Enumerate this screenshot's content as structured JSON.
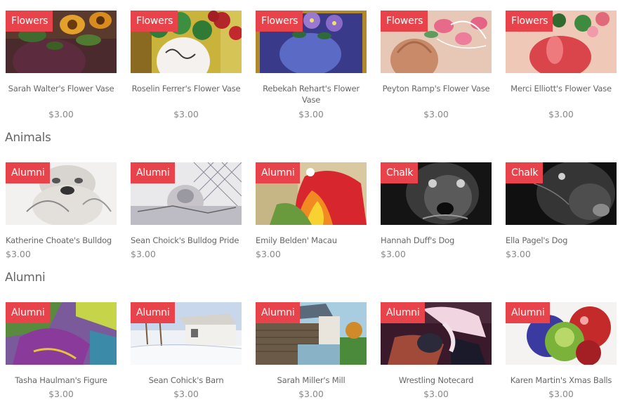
{
  "sections": [
    {
      "heading": "",
      "items": [
        {
          "badge": "Flowers",
          "title": "Sarah Walter's Flower Vase",
          "price": "$3.00",
          "art": "sunflower-vase"
        },
        {
          "badge": "Flowers",
          "title": "Roselin Ferrer's Flower Vase",
          "price": "$3.00",
          "art": "rose-white-vase"
        },
        {
          "badge": "Flowers",
          "title": "Rebekah Rehart's Flower Vase",
          "price": "$3.00",
          "art": "blue-vase-daisies"
        },
        {
          "badge": "Flowers",
          "title": "Peyton Ramp's Flower Vase",
          "price": "$3.00",
          "art": "pink-flowers-vase"
        },
        {
          "badge": "Flowers",
          "title": "Merci Elliott's Flower Vase",
          "price": "$3.00",
          "art": "red-vase-roses"
        }
      ]
    },
    {
      "heading": "Animals",
      "items": [
        {
          "badge": "Alumni",
          "title": "Katherine Choate's Bulldog",
          "price": "$3.00",
          "art": "bulldog-sketch"
        },
        {
          "badge": "Alumni",
          "title": "Sean Choick's Bulldog Pride",
          "price": "$3.00",
          "art": "bulldog-fence"
        },
        {
          "badge": "Alumni",
          "title": "Emily Belden' Macau",
          "price": "$3.00",
          "art": "macaw"
        },
        {
          "badge": "Chalk",
          "title": "Hannah Duff's Dog",
          "price": "$3.00",
          "art": "dog-chalk-1"
        },
        {
          "badge": "Chalk",
          "title": "Ella Pagel's Dog",
          "price": "$3.00",
          "art": "dog-chalk-2"
        }
      ]
    },
    {
      "heading": "Alumni",
      "items": [
        {
          "badge": "Alumni",
          "title": "Tasha Haulman's Figure",
          "price": "$3.00",
          "art": "abstract-figure"
        },
        {
          "badge": "Alumni",
          "title": "Sean Cohick's Barn",
          "price": "$3.00",
          "art": "snowy-barn"
        },
        {
          "badge": "Alumni",
          "title": "Sarah Miller's Mill",
          "price": "$3.00",
          "art": "mill"
        },
        {
          "badge": "Alumni",
          "title": "Wrestling Notecard",
          "price": "$3.00",
          "art": "wrestling"
        },
        {
          "badge": "Alumni",
          "title": "Karen Martin's Xmas Balls",
          "price": "$3.00",
          "art": "xmas-balls"
        }
      ]
    }
  ]
}
